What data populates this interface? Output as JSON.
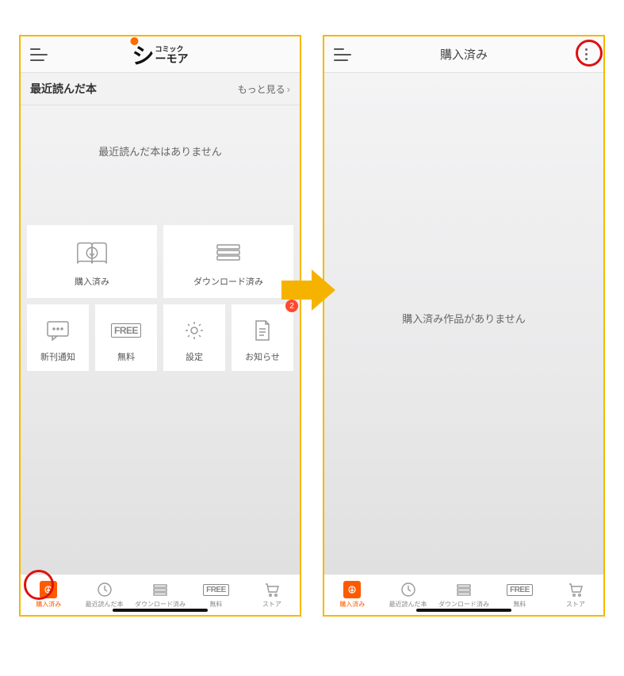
{
  "left": {
    "brand_sub_top": "コミック",
    "brand_main": "ーモア",
    "section_title": "最近読んだ本",
    "more_label": "もっと見る",
    "empty_recent": "最近読んだ本はありません",
    "cards": {
      "purchased": "購入済み",
      "downloaded": "ダウンロード済み",
      "new_notify": "新刊通知",
      "free": "無料",
      "settings": "設定",
      "notice": "お知らせ",
      "notice_badge": "2"
    }
  },
  "right": {
    "title": "購入済み",
    "empty": "購入済み作品がありません"
  },
  "tabs": {
    "purchased": "購入済み",
    "recent": "最近読んだ本",
    "downloaded": "ダウンロード済み",
    "free": "無料",
    "store": "ストア"
  },
  "free_word": "FREE"
}
